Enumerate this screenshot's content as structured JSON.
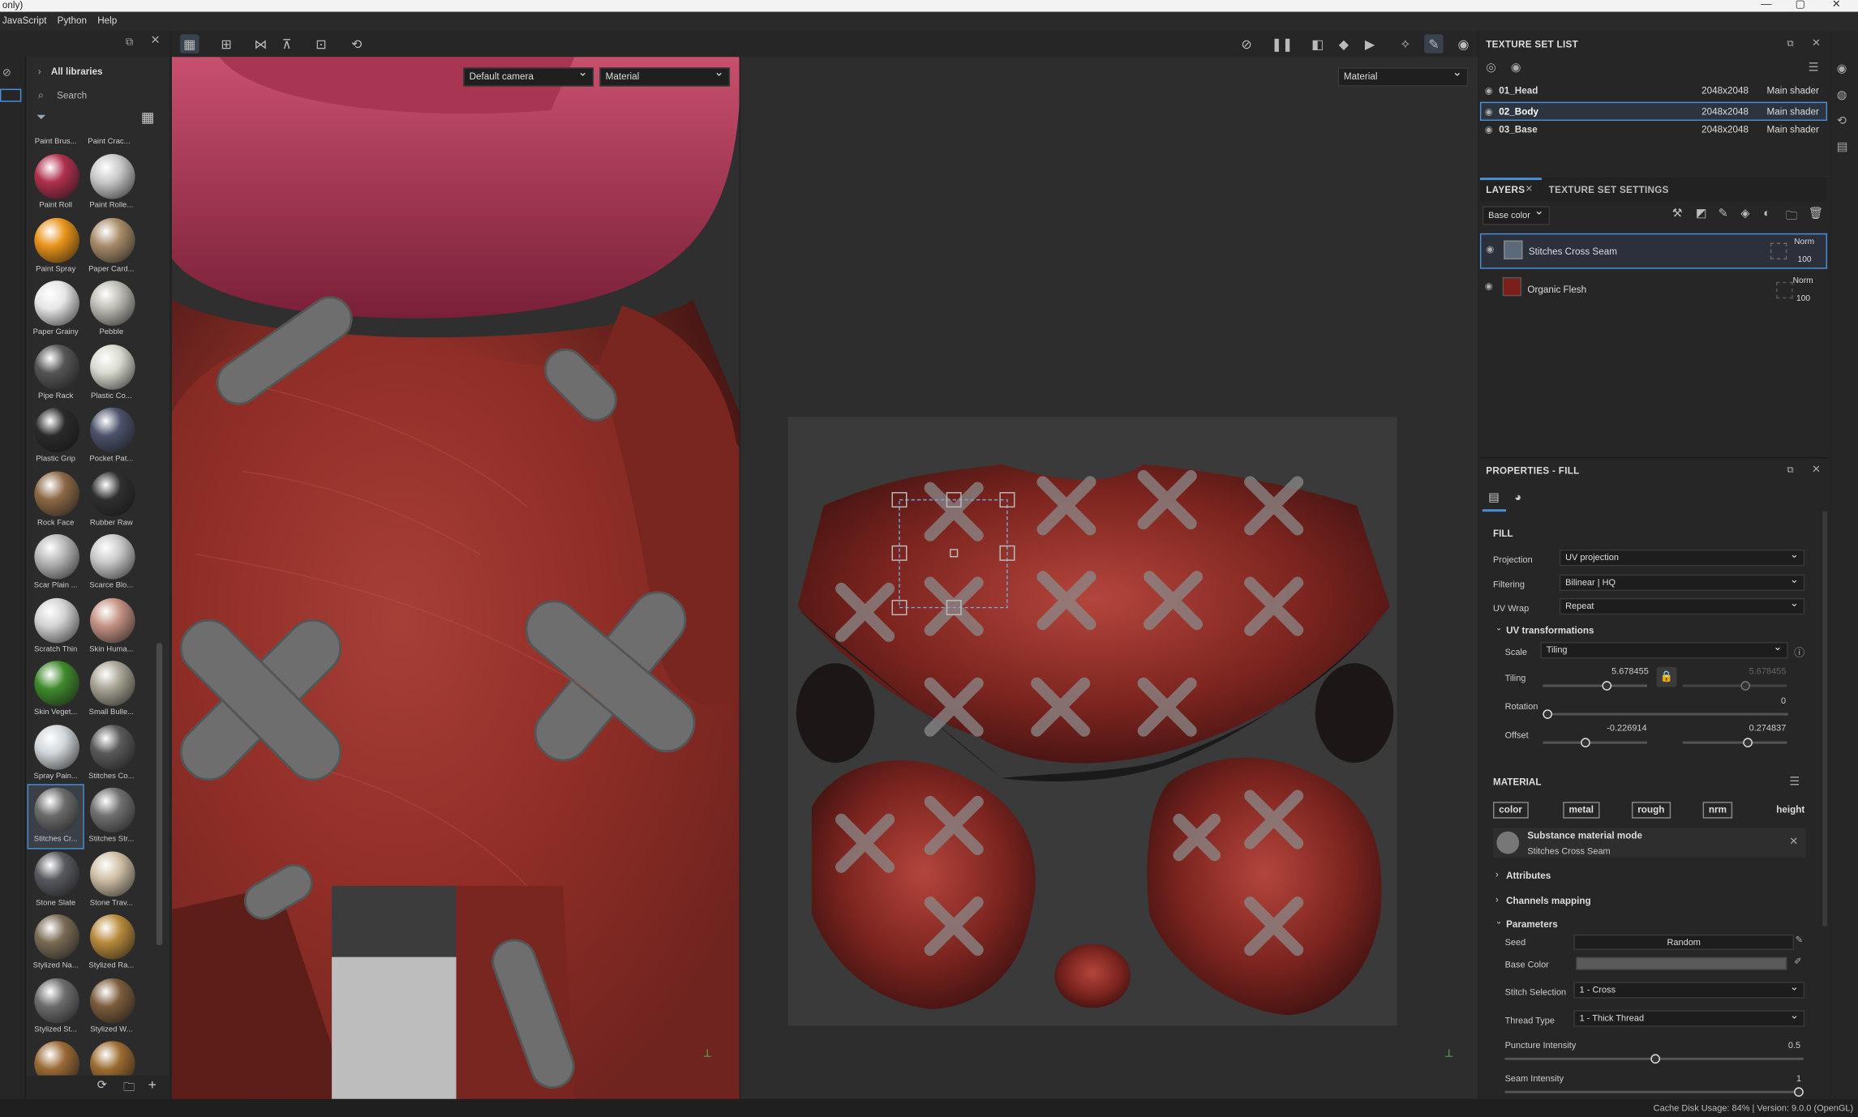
{
  "window": {
    "title": "only)",
    "controls": [
      "—",
      "▢",
      "✕"
    ]
  },
  "menu": [
    "JavaScript",
    "Python",
    "Help"
  ],
  "library": {
    "header": "All libraries",
    "search_placeholder": "Search",
    "top_labels": [
      "Paint Brus...",
      "Paint Crac..."
    ],
    "items": [
      {
        "label": "Paint Roll",
        "color": "#b0304e"
      },
      {
        "label": "Paint Rolle...",
        "color": "#c8c8c8"
      },
      {
        "label": "Paint Spray",
        "color": "#e8941a"
      },
      {
        "label": "Paper Card...",
        "color": "#a88b68"
      },
      {
        "label": "Paper Grainy",
        "color": "#e6e6e6"
      },
      {
        "label": "Pebble",
        "color": "#bdbcb4"
      },
      {
        "label": "Pipe Rack",
        "color": "#555555"
      },
      {
        "label": "Plastic Co...",
        "color": "#d9dacf"
      },
      {
        "label": "Plastic Grip",
        "color": "#2a2a2a"
      },
      {
        "label": "Pocket Pat...",
        "color": "#4b526b"
      },
      {
        "label": "Rock Face",
        "color": "#8c6845"
      },
      {
        "label": "Rubber Raw",
        "color": "#2f2f2f"
      },
      {
        "label": "Scar Plain ...",
        "color": "#b8b8b8"
      },
      {
        "label": "Scarce Blo...",
        "color": "#c9c9c9"
      },
      {
        "label": "Scratch Thin",
        "color": "#d2d2d2"
      },
      {
        "label": "Skin Huma...",
        "color": "#c49182"
      },
      {
        "label": "Skin Veget...",
        "color": "#3f8a2c"
      },
      {
        "label": "Small Bulle...",
        "color": "#a7a494"
      },
      {
        "label": "Spray Pain...",
        "color": "#d0d6da"
      },
      {
        "label": "Stitches Co...",
        "color": "#5a5a5a"
      },
      {
        "label": "Stitches Cr...",
        "color": "#6b6b6b"
      },
      {
        "label": "Stitches Str...",
        "color": "#707070"
      },
      {
        "label": "Stone Slate",
        "color": "#57595e"
      },
      {
        "label": "Stone Trav...",
        "color": "#cfbfa5"
      },
      {
        "label": "Stylized Na...",
        "color": "#7a6a54"
      },
      {
        "label": "Stylized Ra...",
        "color": "#b88a3c"
      },
      {
        "label": "Stylized St...",
        "color": "#6c6c6c"
      },
      {
        "label": "Stylized W...",
        "color": "#7c5c3c"
      },
      {
        "label": "",
        "color": "#9a6a35"
      },
      {
        "label": "",
        "color": "#9c6c30"
      }
    ]
  },
  "viewport": {
    "camera": "Default camera",
    "mode3d": "Material",
    "mode2d": "Material"
  },
  "texture_set_list": {
    "title": "TEXTURE SET LIST",
    "rows": [
      {
        "name": "01_Head",
        "res": "2048x2048",
        "shader": "Main shader"
      },
      {
        "name": "02_Body",
        "res": "2048x2048",
        "shader": "Main shader"
      },
      {
        "name": "03_Base",
        "res": "2048x2048",
        "shader": "Main shader"
      }
    ]
  },
  "layers": {
    "tab_layers": "LAYERS",
    "tab_settings": "TEXTURE SET SETTINGS",
    "channel": "Base color",
    "items": [
      {
        "name": "Stitches Cross Seam",
        "blend": "Norm",
        "opacity": "100"
      },
      {
        "name": "Organic Flesh",
        "blend": "Norm",
        "opacity": "100"
      }
    ]
  },
  "properties": {
    "title": "PROPERTIES - FILL",
    "fill_label": "FILL",
    "projection_label": "Projection",
    "projection": "UV projection",
    "filtering_label": "Filtering",
    "filtering": "Bilinear | HQ",
    "uvwrap_label": "UV Wrap",
    "uvwrap": "Repeat",
    "uvtrans": "UV transformations",
    "scale_label": "Scale",
    "scale": "Tiling",
    "tiling_label": "Tiling",
    "tiling_a": "5.678455",
    "tiling_b": "5.678455",
    "rotation_label": "Rotation",
    "rotation": "0",
    "offset_label": "Offset",
    "offset_a": "-0.226914",
    "offset_b": "0.274837",
    "material_label": "MATERIAL",
    "channels": [
      "color",
      "metal",
      "rough",
      "nrm",
      "height"
    ],
    "mat_mode": "Substance material mode",
    "mat_name": "Stitches Cross Seam",
    "attributes": "Attributes",
    "channels_mapping": "Channels mapping",
    "parameters": "Parameters",
    "seed_label": "Seed",
    "seed": "Random",
    "basecolor_label": "Base Color",
    "stitch_label": "Stitch Selection",
    "stitch": "1 - Cross",
    "thread_label": "Thread Type",
    "thread": "1 - Thick Thread",
    "puncture_label": "Puncture Intensity",
    "puncture": "0.5",
    "seam_label": "Seam Intensity",
    "seam": "1"
  },
  "status": "Cache Disk Usage:   84% | Version: 9.0.0 (OpenGL)"
}
